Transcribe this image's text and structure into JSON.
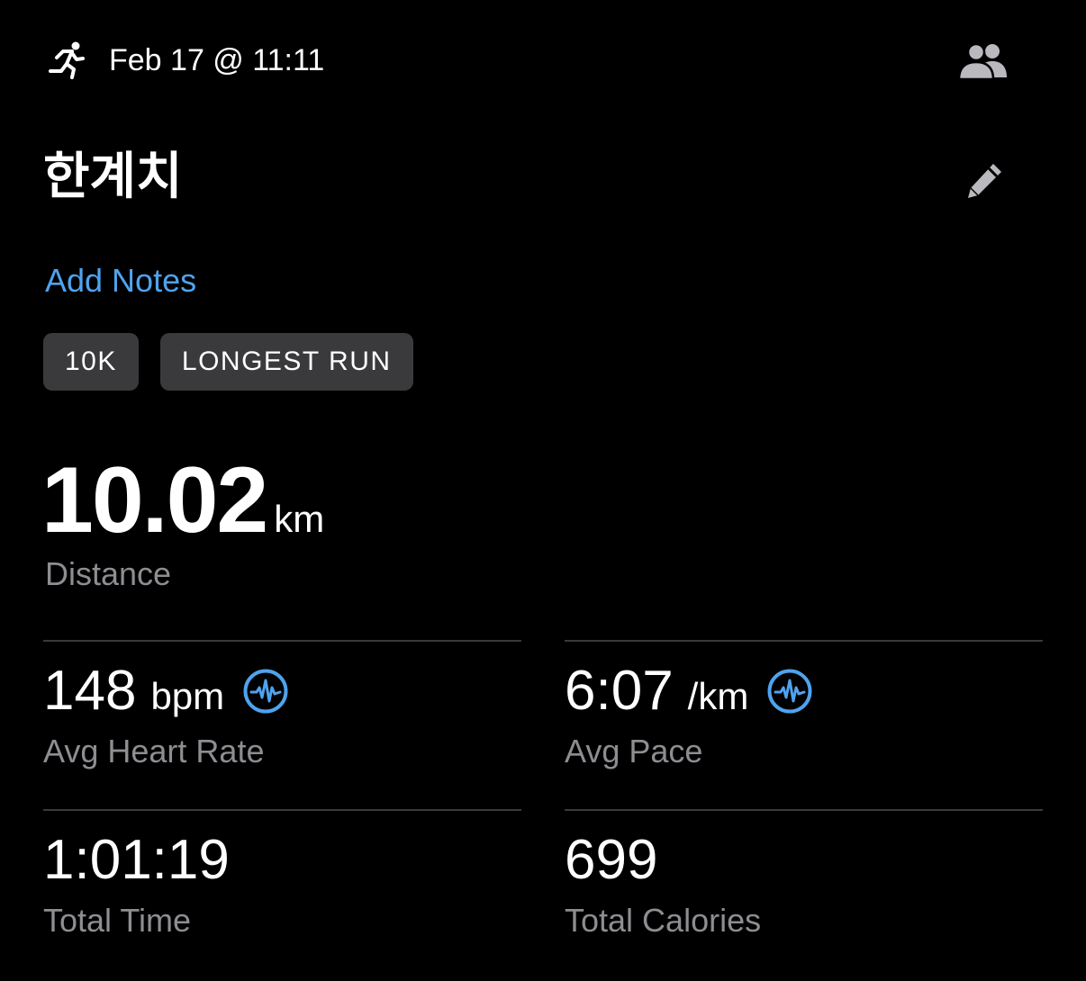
{
  "header": {
    "activity_icon": "running-figure-icon",
    "date": "Feb 17 @ 11:11",
    "share_icon": "people-icon"
  },
  "workout": {
    "title": "한계치",
    "edit_icon": "pencil-icon",
    "add_notes_label": "Add Notes"
  },
  "tags": [
    "10K",
    "LONGEST RUN"
  ],
  "distance": {
    "value": "10.02",
    "unit": "km",
    "label": "Distance"
  },
  "metrics": {
    "heart_rate": {
      "value": "148",
      "unit": "bpm",
      "label": "Avg Heart Rate",
      "icon": "waveform-chart-icon"
    },
    "pace": {
      "value": "6:07",
      "unit": "/km",
      "label": "Avg Pace",
      "icon": "waveform-chart-icon"
    },
    "time": {
      "value": "1:01:19",
      "label": "Total Time"
    },
    "calories": {
      "value": "699",
      "label": "Total Calories"
    }
  },
  "colors": {
    "background": "#000000",
    "text_primary": "#ffffff",
    "text_secondary": "#8d8d92",
    "accent": "#4fa3ee",
    "tag_bg": "#3a3a3c",
    "divider": "#3a3a3c"
  }
}
